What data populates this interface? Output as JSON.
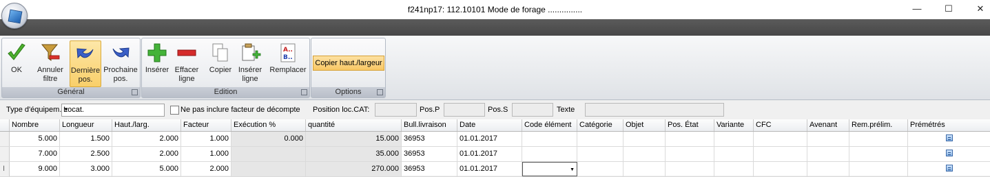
{
  "window": {
    "title": "f241np17: 112.10101 Mode de forage ...............",
    "minimize_glyph": "—",
    "maximize_glyph": "☐",
    "close_glyph": "✕"
  },
  "ribbon": {
    "groups": {
      "general": "Général",
      "edition": "Edition",
      "options": "Options"
    },
    "buttons": {
      "ok": "OK",
      "annuler_filtre": [
        "Annuler",
        "filtre"
      ],
      "derniere_pos": [
        "Dernière",
        "pos."
      ],
      "prochaine_pos": [
        "Prochaine",
        "pos."
      ],
      "inserer": "Insérer",
      "effacer_ligne": [
        "Effacer",
        "ligne"
      ],
      "copier": "Copier",
      "inserer_ligne": [
        "Insérer",
        "ligne"
      ],
      "remplacer": "Remplacer",
      "copier_haut_largeur": "Copier haut./largeur"
    },
    "icons": {
      "ok": "check-icon",
      "annuler_filtre": "remove-filter-icon",
      "derniere_pos": "back-arrow-icon",
      "prochaine_pos": "forward-arrow-icon",
      "inserer": "plus-icon",
      "effacer_ligne": "minus-icon",
      "copier": "copy-icon",
      "inserer_ligne": "insert-line-icon",
      "remplacer": "replace-icon"
    },
    "selected_button": "derniere_pos"
  },
  "filters": {
    "type_label": "Type d'équipem.",
    "type_value": "Locat.",
    "exclude_label": "Ne pas inclure facteur de décompte",
    "exclude_checked": false,
    "position_cat_label": "Position loc.CAT:",
    "position_cat_value": "",
    "posp_label": "Pos.P",
    "posp_value": "",
    "poss_label": "Pos.S",
    "poss_value": "",
    "texte_label": "Texte",
    "texte_value": ""
  },
  "table": {
    "columns": [
      "Nombre",
      "Longueur",
      "Haut./larg.",
      "Facteur",
      "Exécution %",
      "quantité",
      "Bull.livraison",
      "Date",
      "Code élément",
      "Catégorie",
      "Objet",
      "Pos. État",
      "Variante",
      "CFC",
      "Avenant",
      "Rem.prélim.",
      "Prémétrés"
    ],
    "rows": [
      {
        "nombre": "5.000",
        "longueur": "1.500",
        "haut": "2.000",
        "facteur": "1.000",
        "execution": "0.000",
        "quantite": "15.000",
        "bull": "36953",
        "date": "01.01.2017",
        "code": "",
        "categorie": "",
        "objet": "",
        "etat": "",
        "variante": "",
        "cfc": "",
        "avenant": "",
        "rem": "",
        "premetres": "premetres-icon"
      },
      {
        "nombre": "7.000",
        "longueur": "2.500",
        "haut": "2.000",
        "facteur": "1.000",
        "execution": "",
        "quantite": "35.000",
        "bull": "36953",
        "date": "01.01.2017",
        "code": "",
        "categorie": "",
        "objet": "",
        "etat": "",
        "variante": "",
        "cfc": "",
        "avenant": "",
        "rem": "",
        "premetres": "premetres-icon"
      },
      {
        "nombre": "9.000",
        "longueur": "3.000",
        "haut": "5.000",
        "facteur": "2.000",
        "execution": "",
        "quantite": "270.000",
        "bull": "36953",
        "date": "01.01.2017",
        "code": "",
        "categorie": "",
        "objet": "",
        "etat": "",
        "variante": "",
        "cfc": "",
        "avenant": "",
        "rem": "",
        "premetres": "premetres-icon"
      }
    ],
    "active_row": 2,
    "active_column": "Code élément",
    "row_indicator_glyph": "I"
  }
}
